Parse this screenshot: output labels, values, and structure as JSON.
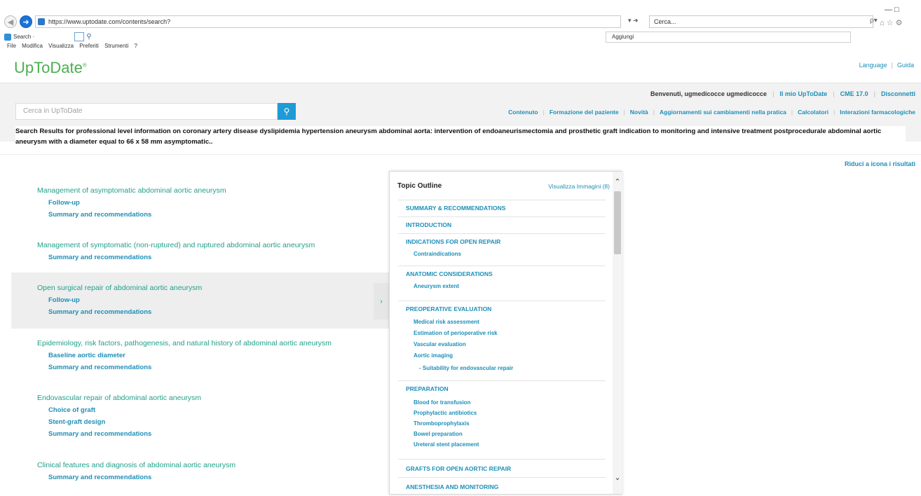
{
  "browser": {
    "address": "https://www.uptodate.com/contents/search?",
    "addr_tools": "▾ ➜",
    "search_placeholder": "Cerca...",
    "search_tools": "ρ▾",
    "right_icons": "⌂ ☆ ⚙",
    "window_controls": "— □",
    "search_toolbar_label": "Search ·",
    "aggiungi": "Aggiungi",
    "menu": [
      "File",
      "Modifica",
      "Visualizza",
      "Preferiti",
      "Strumenti",
      "?"
    ]
  },
  "header": {
    "logo": "UpToDate",
    "logo_mark": "®",
    "language": "Language",
    "guide": "Guida"
  },
  "user_bar": {
    "welcome": "Benvenuti, ugmedicocce ugmedicocce",
    "my_utd": "Il mio UpToDate",
    "cme": "CME 17.0",
    "logout": "Disconnetti"
  },
  "search": {
    "placeholder": "Cerca in UpToDate",
    "button_icon": "search-icon"
  },
  "main_nav": [
    "Contenuto",
    "Formazione del paziente",
    "Novità",
    "Aggiornamenti sui cambiamenti nella pratica",
    "Calcolatori",
    "Interazioni farmacologiche"
  ],
  "results_heading": "Search Results for professional level information on coronary artery disease dyslipidemia hypertension aneurysm abdominal aorta: intervention of endoaneurismectomia and prosthetic graft indication to monitoring and intensive treatment postprocedurale abdominal aortic aneurysm with a diameter equal to 66 x 58 mm asymptomatic..",
  "shrink_link": "Riduci a icona i risultati",
  "results": [
    {
      "title": "Management of asymptomatic abdominal aortic aneurysm",
      "subs": [
        "Follow-up",
        "Summary and recommendations"
      ]
    },
    {
      "title": "Management of symptomatic (non-ruptured) and ruptured abdominal aortic aneurysm",
      "subs": [
        "Summary and recommendations"
      ]
    },
    {
      "title": "Open surgical repair of abdominal aortic aneurysm",
      "subs": [
        "Follow-up",
        "Summary and recommendations"
      ]
    },
    {
      "title": "Epidemiology, risk factors, pathogenesis, and natural history of abdominal aortic aneurysm",
      "subs": [
        "Baseline aortic diameter",
        "Summary and recommendations"
      ]
    },
    {
      "title": "Endovascular repair of abdominal aortic aneurysm",
      "subs": [
        "Choice of graft",
        "Stent-graft design",
        "Summary and recommendations"
      ]
    },
    {
      "title": "Clinical features and diagnosis of abdominal aortic aneurysm",
      "subs": [
        "Summary and recommendations"
      ]
    }
  ],
  "outline": {
    "title": "Topic Outline",
    "images_link": "Visualizza Immagini (8)",
    "collapse_glyph": "›",
    "sections": [
      {
        "title": "SUMMARY & RECOMMENDATIONS",
        "items": []
      },
      {
        "title": "INTRODUCTION",
        "items": []
      },
      {
        "title": "INDICATIONS FOR OPEN REPAIR",
        "items": [
          "Contraindications"
        ]
      },
      {
        "title": "ANATOMIC CONSIDERATIONS",
        "items": [
          "Aneurysm extent"
        ]
      },
      {
        "title": "PREOPERATIVE EVALUATION",
        "items": [
          "Medical risk assessment",
          "Estimation of perioperative risk",
          "Vascular evaluation",
          "Aortic imaging",
          "- Suitability for endovascular repair"
        ]
      },
      {
        "title": "PREPARATION",
        "items": [
          "Blood for transfusion",
          "Prophylactic antibiotics",
          "Thromboprophylaxis",
          "Bowel preparation",
          "Ureteral stent placement"
        ]
      },
      {
        "title": "GRAFTS FOR OPEN AORTIC REPAIR",
        "items": []
      },
      {
        "title": "ANESTHESIA AND MONITORING",
        "items": []
      }
    ]
  }
}
